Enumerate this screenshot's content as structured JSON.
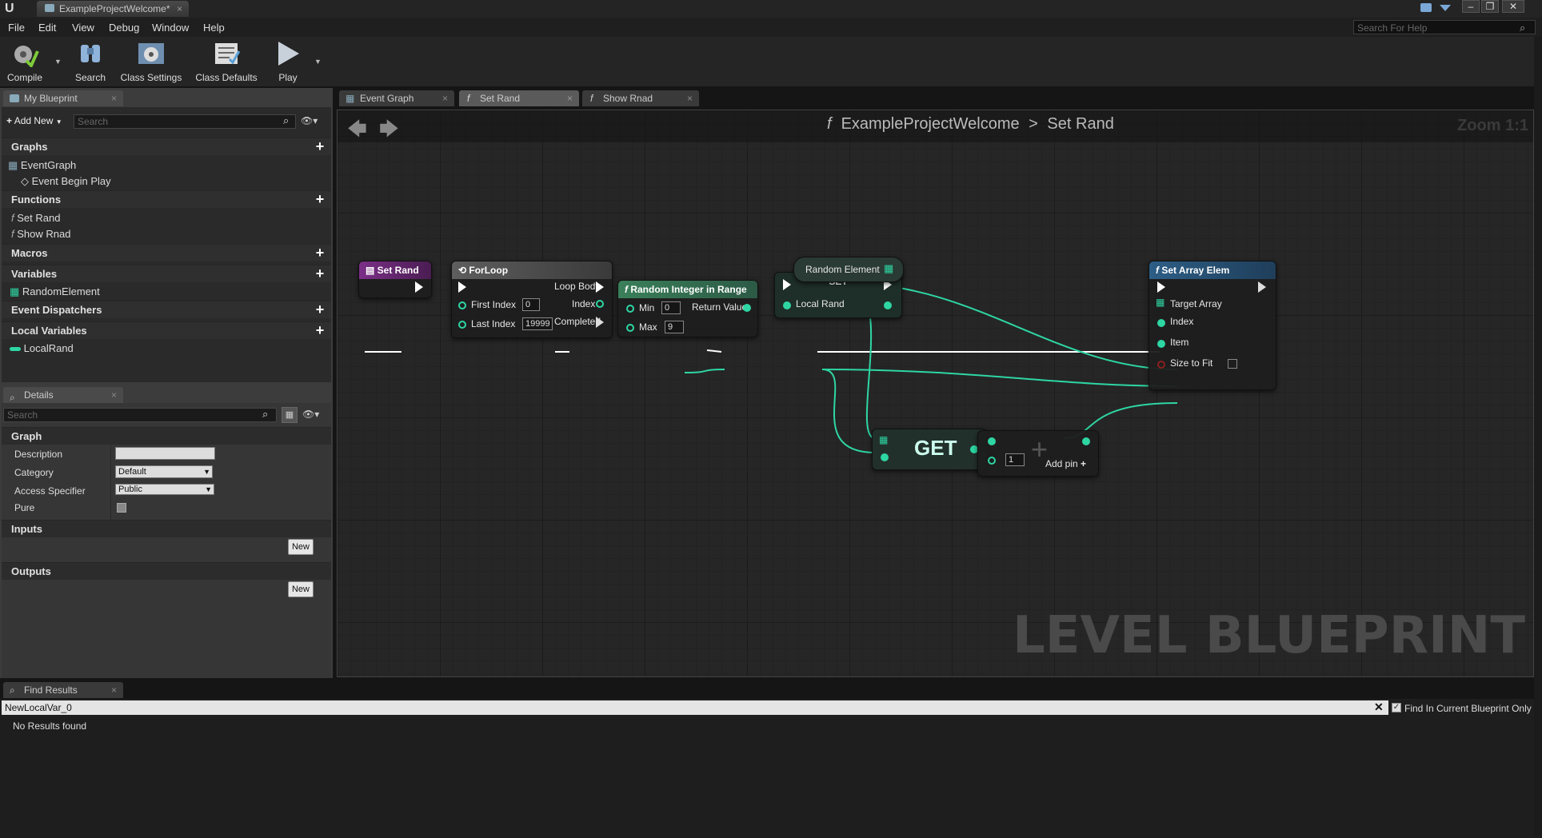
{
  "app": {
    "doc_tab": "ExampleProjectWelcome",
    "logo": "U"
  },
  "menu": [
    "File",
    "Edit",
    "View",
    "Debug",
    "Window",
    "Help"
  ],
  "help_search_placeholder": "Search For Help",
  "toolbar": {
    "compile": "Compile",
    "search": "Search",
    "class_settings": "Class Settings",
    "class_defaults": "Class Defaults",
    "play": "Play"
  },
  "my_blueprint": {
    "tab": "My Blueprint",
    "add_new": "Add New",
    "search_placeholder": "Search",
    "graphs_header": "Graphs",
    "graphs": [
      "EventGraph",
      "Event Begin Play"
    ],
    "functions_header": "Functions",
    "functions": [
      "Set Rand",
      "Show Rnad"
    ],
    "macros_header": "Macros",
    "variables_header": "Variables",
    "variables": [
      "RandomElement"
    ],
    "dispatchers_header": "Event Dispatchers",
    "local_vars_header": "Local Variables",
    "local_vars": [
      "LocalRand"
    ]
  },
  "details": {
    "tab": "Details",
    "search_placeholder": "Search",
    "graph_header": "Graph",
    "description_label": "Description",
    "category_label": "Category",
    "category_value": "Default",
    "access_label": "Access Specifier",
    "access_value": "Public",
    "pure_label": "Pure",
    "inputs_header": "Inputs",
    "outputs_header": "Outputs",
    "new_label": "New"
  },
  "graph_tabs": [
    "Event Graph",
    "Set Rand",
    "Show Rnad"
  ],
  "breadcrumb": {
    "root": "ExampleProjectWelcome",
    "sep": ">",
    "current": "Set Rand"
  },
  "zoom": "Zoom 1:1",
  "watermark": "LEVEL BLUEPRINT",
  "nodes": {
    "set_rand": {
      "title": "Set Rand"
    },
    "forloop": {
      "title": "ForLoop",
      "first_index_label": "First Index",
      "first_index": "0",
      "last_index_label": "Last Index",
      "last_index": "19999",
      "loop_body": "Loop Body",
      "index": "Index",
      "completed": "Completed"
    },
    "random_int": {
      "title": "Random Integer in Range",
      "min_label": "Min",
      "min": "0",
      "max_label": "Max",
      "max": "9",
      "return_label": "Return Value"
    },
    "set": {
      "title": "SET",
      "local_rand": "Local Rand"
    },
    "random_element": {
      "title": "Random Element"
    },
    "get": {
      "title": "GET"
    },
    "add": {
      "value": "1",
      "add_pin": "Add pin"
    },
    "set_array": {
      "title": "Set Array Elem",
      "target": "Target Array",
      "index": "Index",
      "item": "Item",
      "size_to_fit": "Size to Fit"
    }
  },
  "find_results": {
    "tab": "Find Results",
    "query": "NewLocalVar_0",
    "find_in_current": "Find In Current Blueprint Only",
    "result": "No Results found"
  },
  "colors": {
    "pin_green": "#2ed6a3",
    "function_blue": "#2d5e86",
    "event_purple": "#6b2a76",
    "loop_gray": "#4a4a4a"
  }
}
